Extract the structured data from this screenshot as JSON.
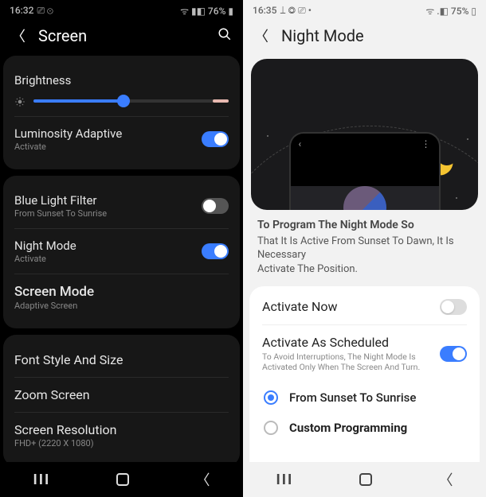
{
  "left": {
    "status": {
      "time": "16:32",
      "icons": "⎚ ⊙",
      "right": "ᯤ ▮◧ 76% ▮"
    },
    "header": {
      "title": "Screen"
    },
    "brightness": {
      "label": "Brightness"
    },
    "luminosity": {
      "label": "Luminosity Adaptive",
      "sub": "Activate"
    },
    "bluelight": {
      "label": "Blue Light Filter",
      "sub": "From Sunset To Sunrise"
    },
    "nightmode": {
      "label": "Night Mode",
      "sub": "Activate"
    },
    "screenmode": {
      "label": "Screen Mode",
      "sub": "Adaptive Screen"
    },
    "font": {
      "label": "Font Style And Size"
    },
    "zoom": {
      "label": "Zoom Screen"
    },
    "resolution": {
      "label": "Screen Resolution",
      "sub": "FHD+ (2220 X 1080)"
    }
  },
  "right": {
    "status": {
      "time": "16:35",
      "icons": "⟘ ◎ ⎚ •",
      "right": "ᯤ .◧ 75% ▯"
    },
    "header": {
      "title": "Night Mode"
    },
    "info": {
      "title": "To Program The Night Mode So",
      "line1": "That It Is Active From Sunset To Dawn, It Is Necessary",
      "line2": "Activate The Position."
    },
    "activate_now": {
      "label": "Activate Now"
    },
    "scheduled": {
      "label": "Activate As Scheduled",
      "sub": "To Avoid Interruptions, The Night Mode Is Activated Only When The Screen And Turn."
    },
    "radio1": {
      "label": "From Sunset To Sunrise"
    },
    "radio2": {
      "label": "Custom Programming"
    }
  }
}
